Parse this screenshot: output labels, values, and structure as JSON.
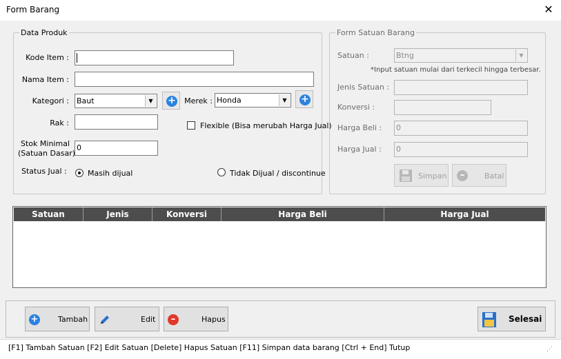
{
  "window": {
    "title": "Form Barang",
    "close_glyph": "✕"
  },
  "data_produk": {
    "legend": "Data Produk",
    "kode_item": {
      "label": "Kode Item :",
      "value": ""
    },
    "nama_item": {
      "label": "Nama Item :",
      "value": ""
    },
    "kategori": {
      "label": "Kategori :",
      "value": "Baut"
    },
    "merek": {
      "label": "Merek :",
      "value": "Honda"
    },
    "rak": {
      "label": "Rak :",
      "value": ""
    },
    "flexible": {
      "label": "Flexible (Bisa merubah Harga Jual)",
      "checked": false
    },
    "stok_minimal": {
      "label_line1": "Stok Minimal",
      "label_line2": "(Satuan Dasar)",
      "value": "0"
    },
    "status_jual": {
      "label": "Status Jual :",
      "option1": "Masih dijual",
      "option2": "Tidak Dijual / discontinue",
      "selected": "Masih dijual"
    }
  },
  "form_satuan": {
    "legend": "Form Satuan Barang",
    "satuan": {
      "label": "Satuan :",
      "value": "Btng"
    },
    "note": "*Input satuan mulai dari terkecil hingga terbesar.",
    "jenis_satuan": {
      "label": "Jenis Satuan :",
      "value": ""
    },
    "konversi": {
      "label": "Konversi :",
      "value": ""
    },
    "harga_beli": {
      "label": "Harga Beli :",
      "value": "0"
    },
    "harga_jual": {
      "label": "Harga Jual :",
      "value": "0"
    },
    "simpan_label": "Simpan",
    "batal_label": "Batal"
  },
  "table": {
    "columns": [
      "Satuan",
      "Jenis",
      "Konversi",
      "Harga Beli",
      "Harga Jual"
    ],
    "rows": []
  },
  "actions": {
    "tambah_label": "Tambah",
    "edit_label": "Edit",
    "hapus_label": "Hapus",
    "selesai_label": "Selesai"
  },
  "statusbar": {
    "text": "[F1] Tambah Satuan  [F2] Edit Satuan  [Delete] Hapus Satuan  [F11] Simpan data barang  [Ctrl + End] Tutup"
  },
  "colors": {
    "accent_blue": "#2b82e0",
    "delete_red": "#e0392b",
    "grid_header": "#4d4d4d"
  },
  "icons": {
    "add": "plus-circle-icon",
    "edit": "pencil-icon",
    "delete": "minus-circle-icon",
    "save": "floppy-disk-icon",
    "finish": "save-document-icon"
  }
}
